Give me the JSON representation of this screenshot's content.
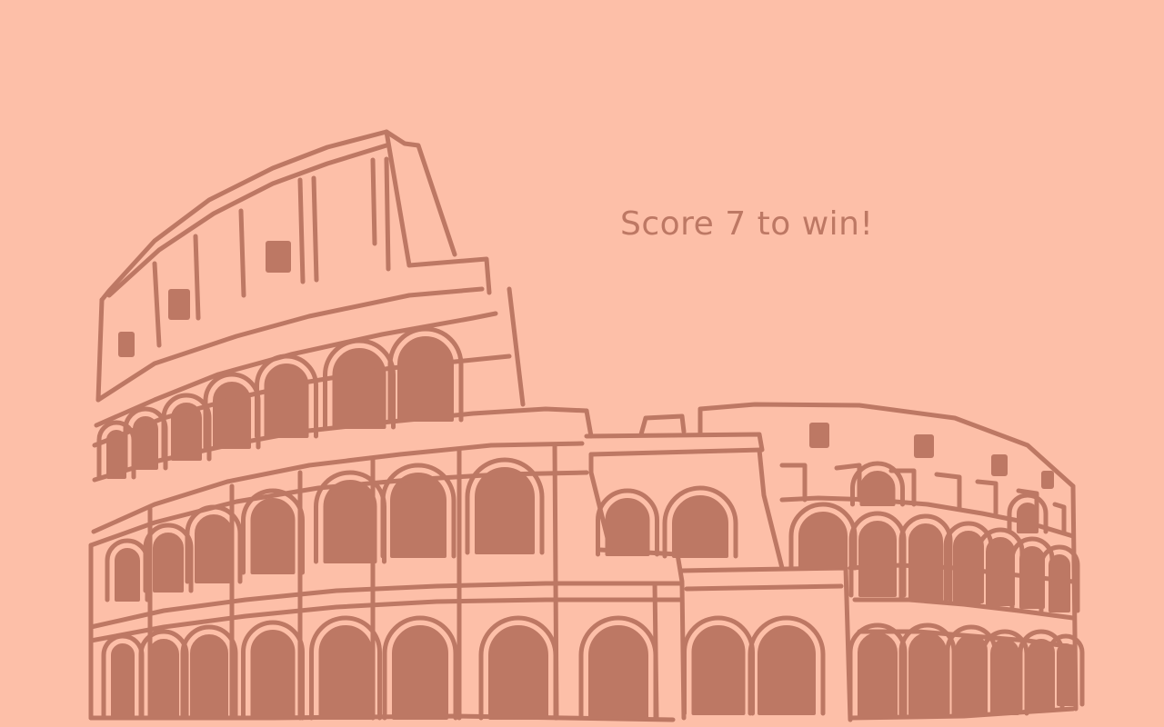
{
  "game": {
    "goal_text": "Score 7 to win!"
  },
  "colors": {
    "background": "#fdbfa8",
    "ink": "#bd7864"
  },
  "illustration": {
    "subject": "colosseum-line-drawing"
  }
}
